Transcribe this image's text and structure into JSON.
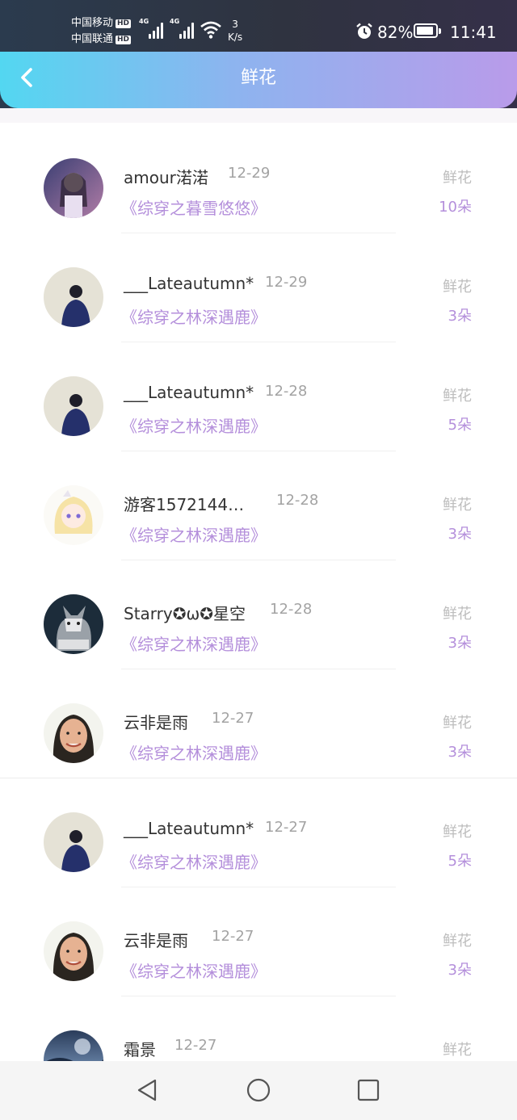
{
  "status_bar": {
    "carrier1": "中国移动",
    "carrier2": "中国联通",
    "hd": "HD",
    "net1": "4G",
    "net2": "4G",
    "speed_value": "3",
    "speed_unit": "K/s",
    "battery": "82%",
    "time": "11:41"
  },
  "header": {
    "title": "鲜花"
  },
  "records": [
    {
      "name": "amour渃渃",
      "date": "12-29",
      "book": "《综穿之暮雪悠悠》",
      "gift_type": "鲜花",
      "gift_count": "10朵"
    },
    {
      "name": "___Lateautumn*",
      "date": "12-29",
      "book": "《综穿之林深遇鹿》",
      "gift_type": "鲜花",
      "gift_count": "3朵"
    },
    {
      "name": "___Lateautumn*",
      "date": "12-28",
      "book": "《综穿之林深遇鹿》",
      "gift_type": "鲜花",
      "gift_count": "5朵"
    },
    {
      "name": "游客1572144…",
      "date": "12-28",
      "book": "《综穿之林深遇鹿》",
      "gift_type": "鲜花",
      "gift_count": "3朵"
    },
    {
      "name": "Starry✪ω✪星空",
      "date": "12-28",
      "book": "《综穿之林深遇鹿》",
      "gift_type": "鲜花",
      "gift_count": "3朵"
    },
    {
      "name": "云非是雨",
      "date": "12-27",
      "book": "《综穿之林深遇鹿》",
      "gift_type": "鲜花",
      "gift_count": "3朵"
    },
    {
      "name": "___Lateautumn*",
      "date": "12-27",
      "book": "《综穿之林深遇鹿》",
      "gift_type": "鲜花",
      "gift_count": "5朵"
    },
    {
      "name": "云非是雨",
      "date": "12-27",
      "book": "《综穿之林深遇鹿》",
      "gift_type": "鲜花",
      "gift_count": "3朵"
    },
    {
      "name": "霜景",
      "date": "12-27",
      "book": "",
      "gift_type": "鲜花",
      "gift_count": ""
    }
  ],
  "nav_icons": [
    "back-triangle-icon",
    "home-circle-icon",
    "recents-square-icon"
  ]
}
